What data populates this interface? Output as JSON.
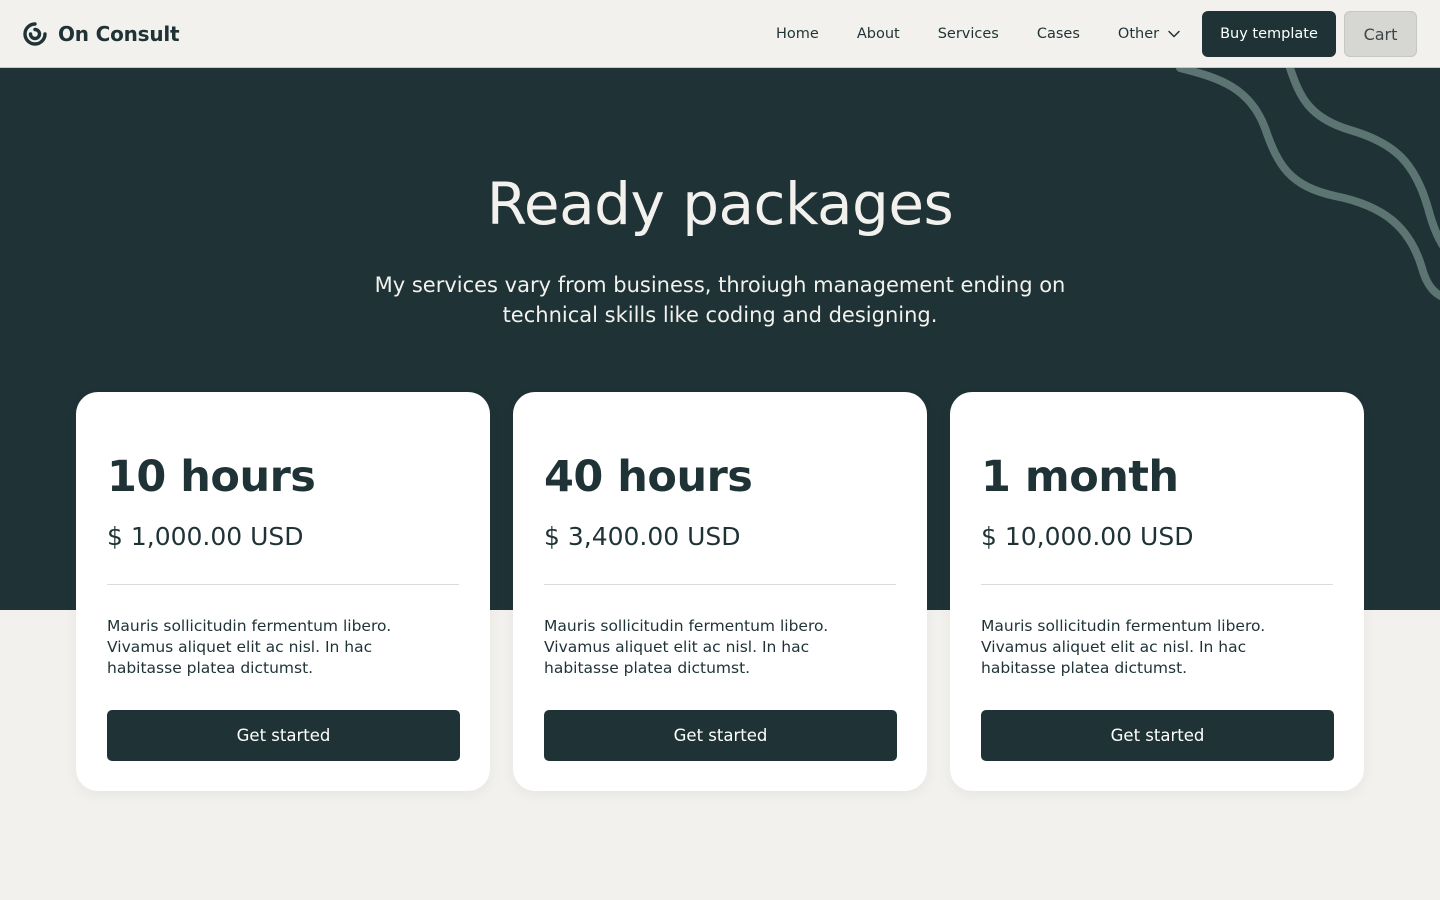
{
  "header": {
    "brand": "On Consult",
    "nav": [
      {
        "label": "Home"
      },
      {
        "label": "About"
      },
      {
        "label": "Services"
      },
      {
        "label": "Cases"
      },
      {
        "label": "Other"
      }
    ],
    "buy_label": "Buy template",
    "cart_label": "Cart"
  },
  "hero": {
    "title": "Ready packages",
    "subtitle": "My services vary from business, throiugh management ending on technical skills like coding and designing."
  },
  "packages": [
    {
      "title": "10 hours",
      "price": "$ 1,000.00 USD",
      "description": "Mauris sollicitudin fermentum libero. Vivamus aliquet elit ac nisl. In hac habitasse platea dictumst.",
      "button": "Get started"
    },
    {
      "title": "40 hours",
      "price": "$ 3,400.00 USD",
      "description": "Mauris sollicitudin fermentum libero. Vivamus aliquet elit ac nisl. In hac habitasse platea dictumst.",
      "button": "Get started"
    },
    {
      "title": "1 month",
      "price": "$ 10,000.00 USD",
      "description": "Mauris sollicitudin fermentum libero. Vivamus aliquet elit ac nisl. In hac habitasse platea dictumst.",
      "button": "Get started"
    }
  ],
  "icons": {
    "brand": "logo-swirl-icon",
    "other_dropdown": "chevron-down-icon"
  },
  "colors": {
    "primary": "#1f3336",
    "background": "#f2f1ed",
    "card": "#ffffff",
    "cart_button": "#d6d6d3",
    "wave": "#5d7572"
  }
}
